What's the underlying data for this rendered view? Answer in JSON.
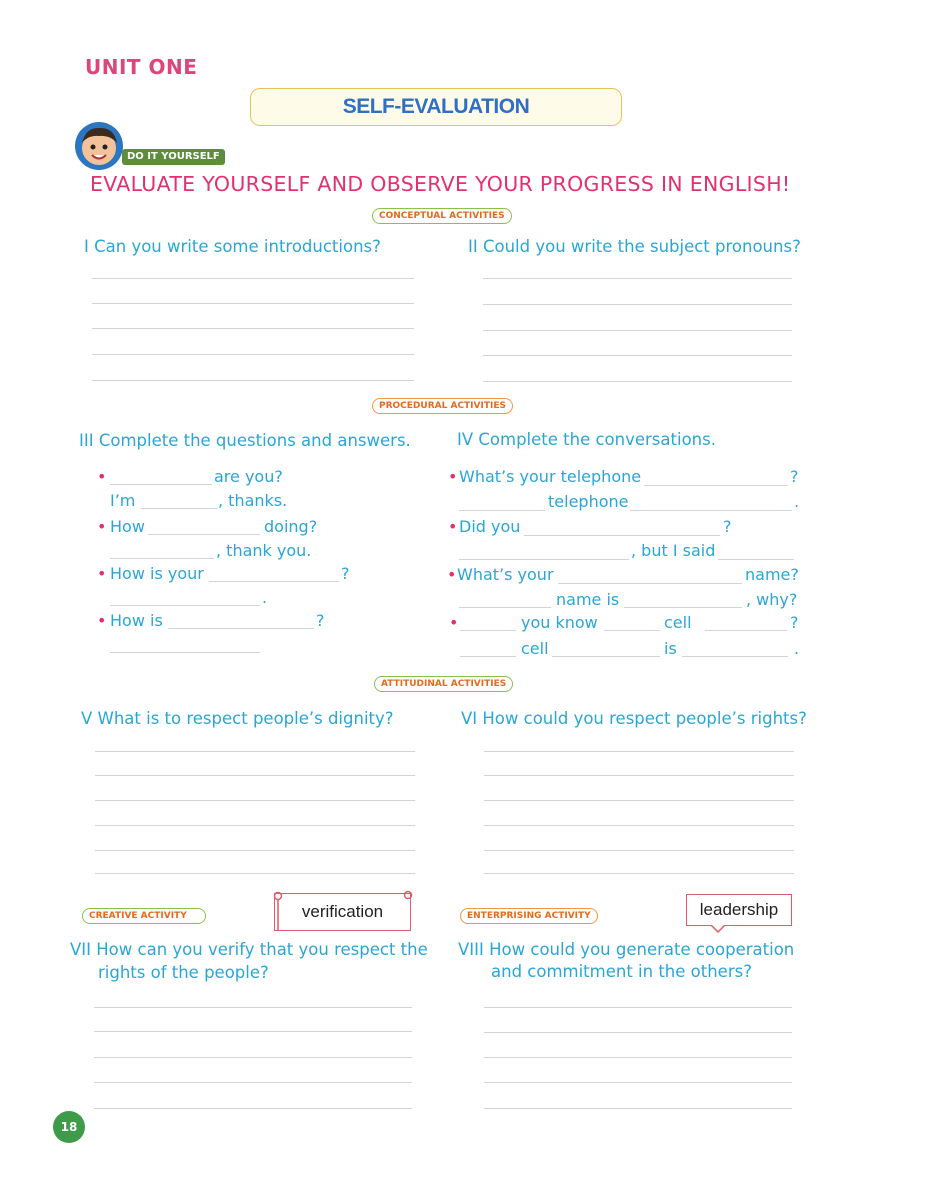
{
  "header": {
    "unit": "UNIT ONE",
    "title": "SELF-EVALUATION",
    "badge": "DO IT YOURSELF",
    "headline": "EVALUATE YOURSELF AND OBSERVE YOUR PROGRESS IN ENGLISH!"
  },
  "sections": {
    "conceptual": "CONCEPTUAL ACTIVITIES",
    "procedural": "PROCEDURAL ACTIVITIES",
    "attitudinal": "ATTITUDINAL ACTIVITIES",
    "creative": "CREATIVE ACTIVITY",
    "enterprising": "ENTERPRISING ACTIVITY"
  },
  "questions": {
    "q1": "I Can you write some introductions?",
    "q2": "II Could you write the subject pronouns?",
    "q3": "III Complete the questions and answers.",
    "q4": "IV Complete the conversations.",
    "q5": "V What is to respect people’s dignity?",
    "q6": "VI How could you respect people’s rights?",
    "q7_line1": "VII How can you verify that you respect the",
    "q7_line2": "rights of the people?",
    "q8_line1": "VIII How could you generate cooperation",
    "q8_line2": "and commitment in the others?"
  },
  "exercise3": {
    "a1": "are you?",
    "a2": "I’m",
    "a3": ", thanks.",
    "b1": "How",
    "b2": "doing?",
    "b3": ", thank you.",
    "c1": "How is your",
    "c2": "?",
    "c3": ".",
    "d1": "How is",
    "d2": "?"
  },
  "exercise4": {
    "a1": "What’s your telephone",
    "a2": "?",
    "a3": "telephone",
    "a4": ".",
    "b1": "Did you",
    "b2": "?",
    "b3": ", but I said",
    "c1": "What’s your",
    "c2": "name?",
    "c3": "name is",
    "c4": ", why?",
    "d1": "you know",
    "d2": "cell",
    "d3": "?",
    "d4": "cell",
    "d5": "is",
    "d6": "."
  },
  "notes": {
    "verification": "verification",
    "leadership": "leadership"
  },
  "page_number": "18",
  "colors": {
    "question_blue": "#2aa6d6",
    "headline_pink": "#e3306f",
    "title_blue": "#2f6fc4"
  }
}
